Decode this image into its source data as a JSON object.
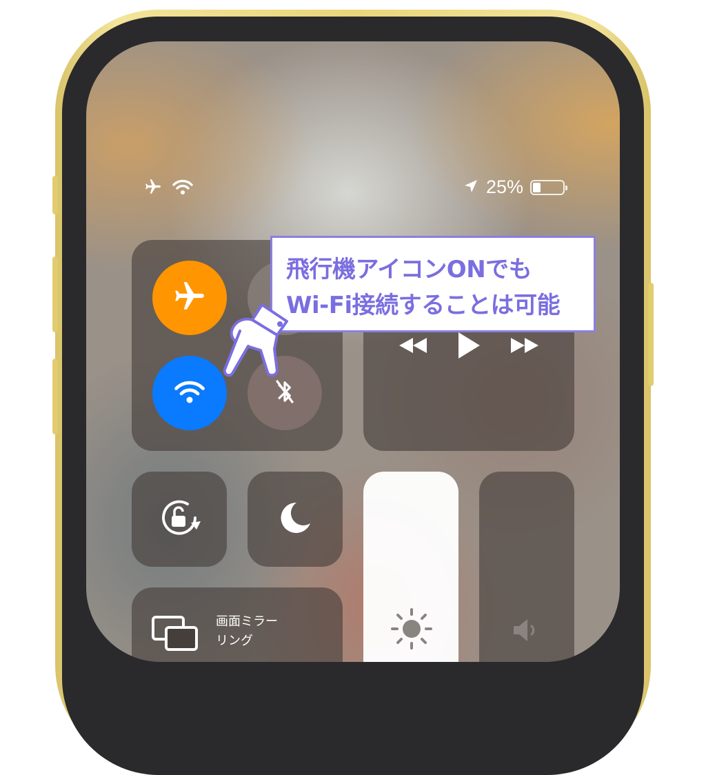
{
  "status_bar": {
    "airplane_icon": "airplane-icon",
    "wifi_icon": "wifi-icon",
    "location_icon": "location-arrow-icon",
    "battery_text": "25%",
    "battery_level": 0.25
  },
  "connectivity": {
    "airplane": {
      "icon": "airplane-icon",
      "on": true,
      "color": "#ff9500"
    },
    "cellular": {
      "icon": "cellular-icon",
      "on": false
    },
    "wifi": {
      "icon": "wifi-icon",
      "on": true,
      "color": "#0a7aff"
    },
    "bluetooth": {
      "icon": "bluetooth-off-icon",
      "on": false
    }
  },
  "media": {
    "prev_icon": "rewind-icon",
    "play_icon": "play-icon",
    "next_icon": "fast-forward-icon"
  },
  "controls": {
    "rotation_lock_icon": "rotation-lock-icon",
    "dnd_icon": "moon-icon",
    "brightness_icon": "sun-icon",
    "brightness_level": 1.0,
    "volume_icon": "speaker-icon",
    "volume_level": 0.08
  },
  "screen_mirroring": {
    "icon": "screen-mirroring-icon",
    "label_line1": "画面ミラー",
    "label_line2": "リング"
  },
  "annotation": {
    "line1": "飛行機アイコンONでも",
    "line2": "Wi-Fi接続することは可能",
    "border_color": "#8a7fe0",
    "text_color": "#7a6ee0",
    "pointer_icon": "pointing-hand-icon"
  }
}
